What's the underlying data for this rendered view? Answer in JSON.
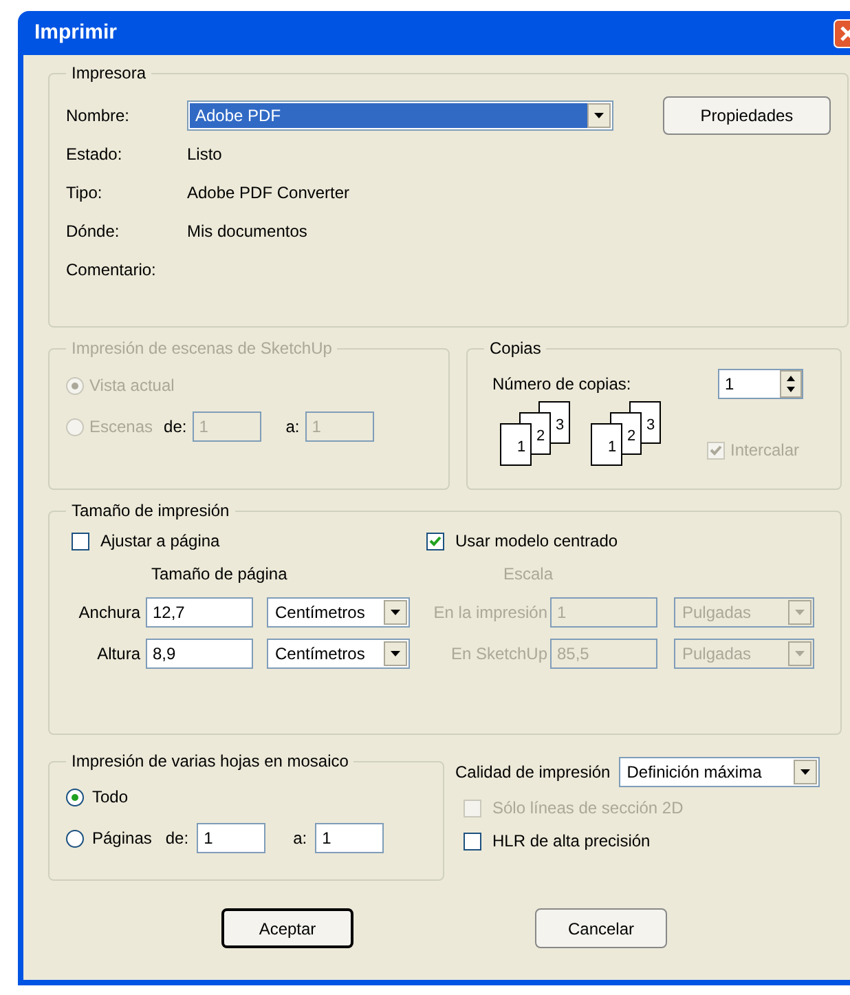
{
  "window": {
    "title": "Imprimir"
  },
  "printer": {
    "legend": "Impresora",
    "name_label": "Nombre:",
    "name_value": "Adobe PDF",
    "properties_button": "Propiedades",
    "info": [
      {
        "label": "Estado:",
        "value": "Listo"
      },
      {
        "label": "Tipo:",
        "value": "Adobe PDF Converter"
      },
      {
        "label": "Dónde:",
        "value": "Mis documentos"
      },
      {
        "label": "Comentario:"
      }
    ]
  },
  "scenes": {
    "legend": "Impresión de escenas de SketchUp",
    "disabled": true,
    "options": [
      {
        "label": "Vista actual",
        "selected": true
      },
      {
        "label": "Escenas",
        "selected": false,
        "from_label": "de:",
        "from": "1",
        "to_label": "a:",
        "to": "1"
      }
    ]
  },
  "copies": {
    "legend": "Copias",
    "label": "Número de copias:",
    "value": "1",
    "stacks": [
      [
        "1",
        "2",
        "3"
      ],
      [
        "1",
        "2",
        "3"
      ]
    ],
    "collate": {
      "label": "Intercalar",
      "checked": true,
      "disabled": true
    }
  },
  "print_size": {
    "legend": "Tamaño de impresión",
    "fit": {
      "label": "Ajustar a página",
      "checked": false
    },
    "center": {
      "label": "Usar modelo centrado",
      "checked": true
    },
    "page_size_heading": "Tamaño de página",
    "scale_heading": "Escala",
    "scale_disabled": true,
    "rows": [
      {
        "label": "Anchura",
        "value": "12,7",
        "unit": "Centímetros",
        "scale_label": "En la impresión",
        "scale_value": "1",
        "scale_unit": "Pulgadas"
      },
      {
        "label": "Altura",
        "value": "8,9",
        "unit": "Centímetros",
        "scale_label": "En SketchUp",
        "scale_value": "85,5",
        "scale_unit": "Pulgadas"
      }
    ]
  },
  "tiling": {
    "legend": "Impresión de varias hojas en mosaico",
    "options": [
      {
        "label": "Todo",
        "selected": true
      },
      {
        "label": "Páginas",
        "selected": false,
        "from_label": "de:",
        "from": "1",
        "to_label": "a:",
        "to": "1"
      }
    ]
  },
  "quality": {
    "label": "Calidad de impresión",
    "value": "Definición máxima",
    "options": [
      {
        "label": "Sólo líneas de sección 2D",
        "checked": false,
        "disabled": true
      },
      {
        "label": "HLR de alta precisión",
        "checked": false,
        "disabled": false
      }
    ]
  },
  "buttons": [
    {
      "label": "Aceptar",
      "default": true
    },
    {
      "label": "Cancelar",
      "default": false
    }
  ]
}
